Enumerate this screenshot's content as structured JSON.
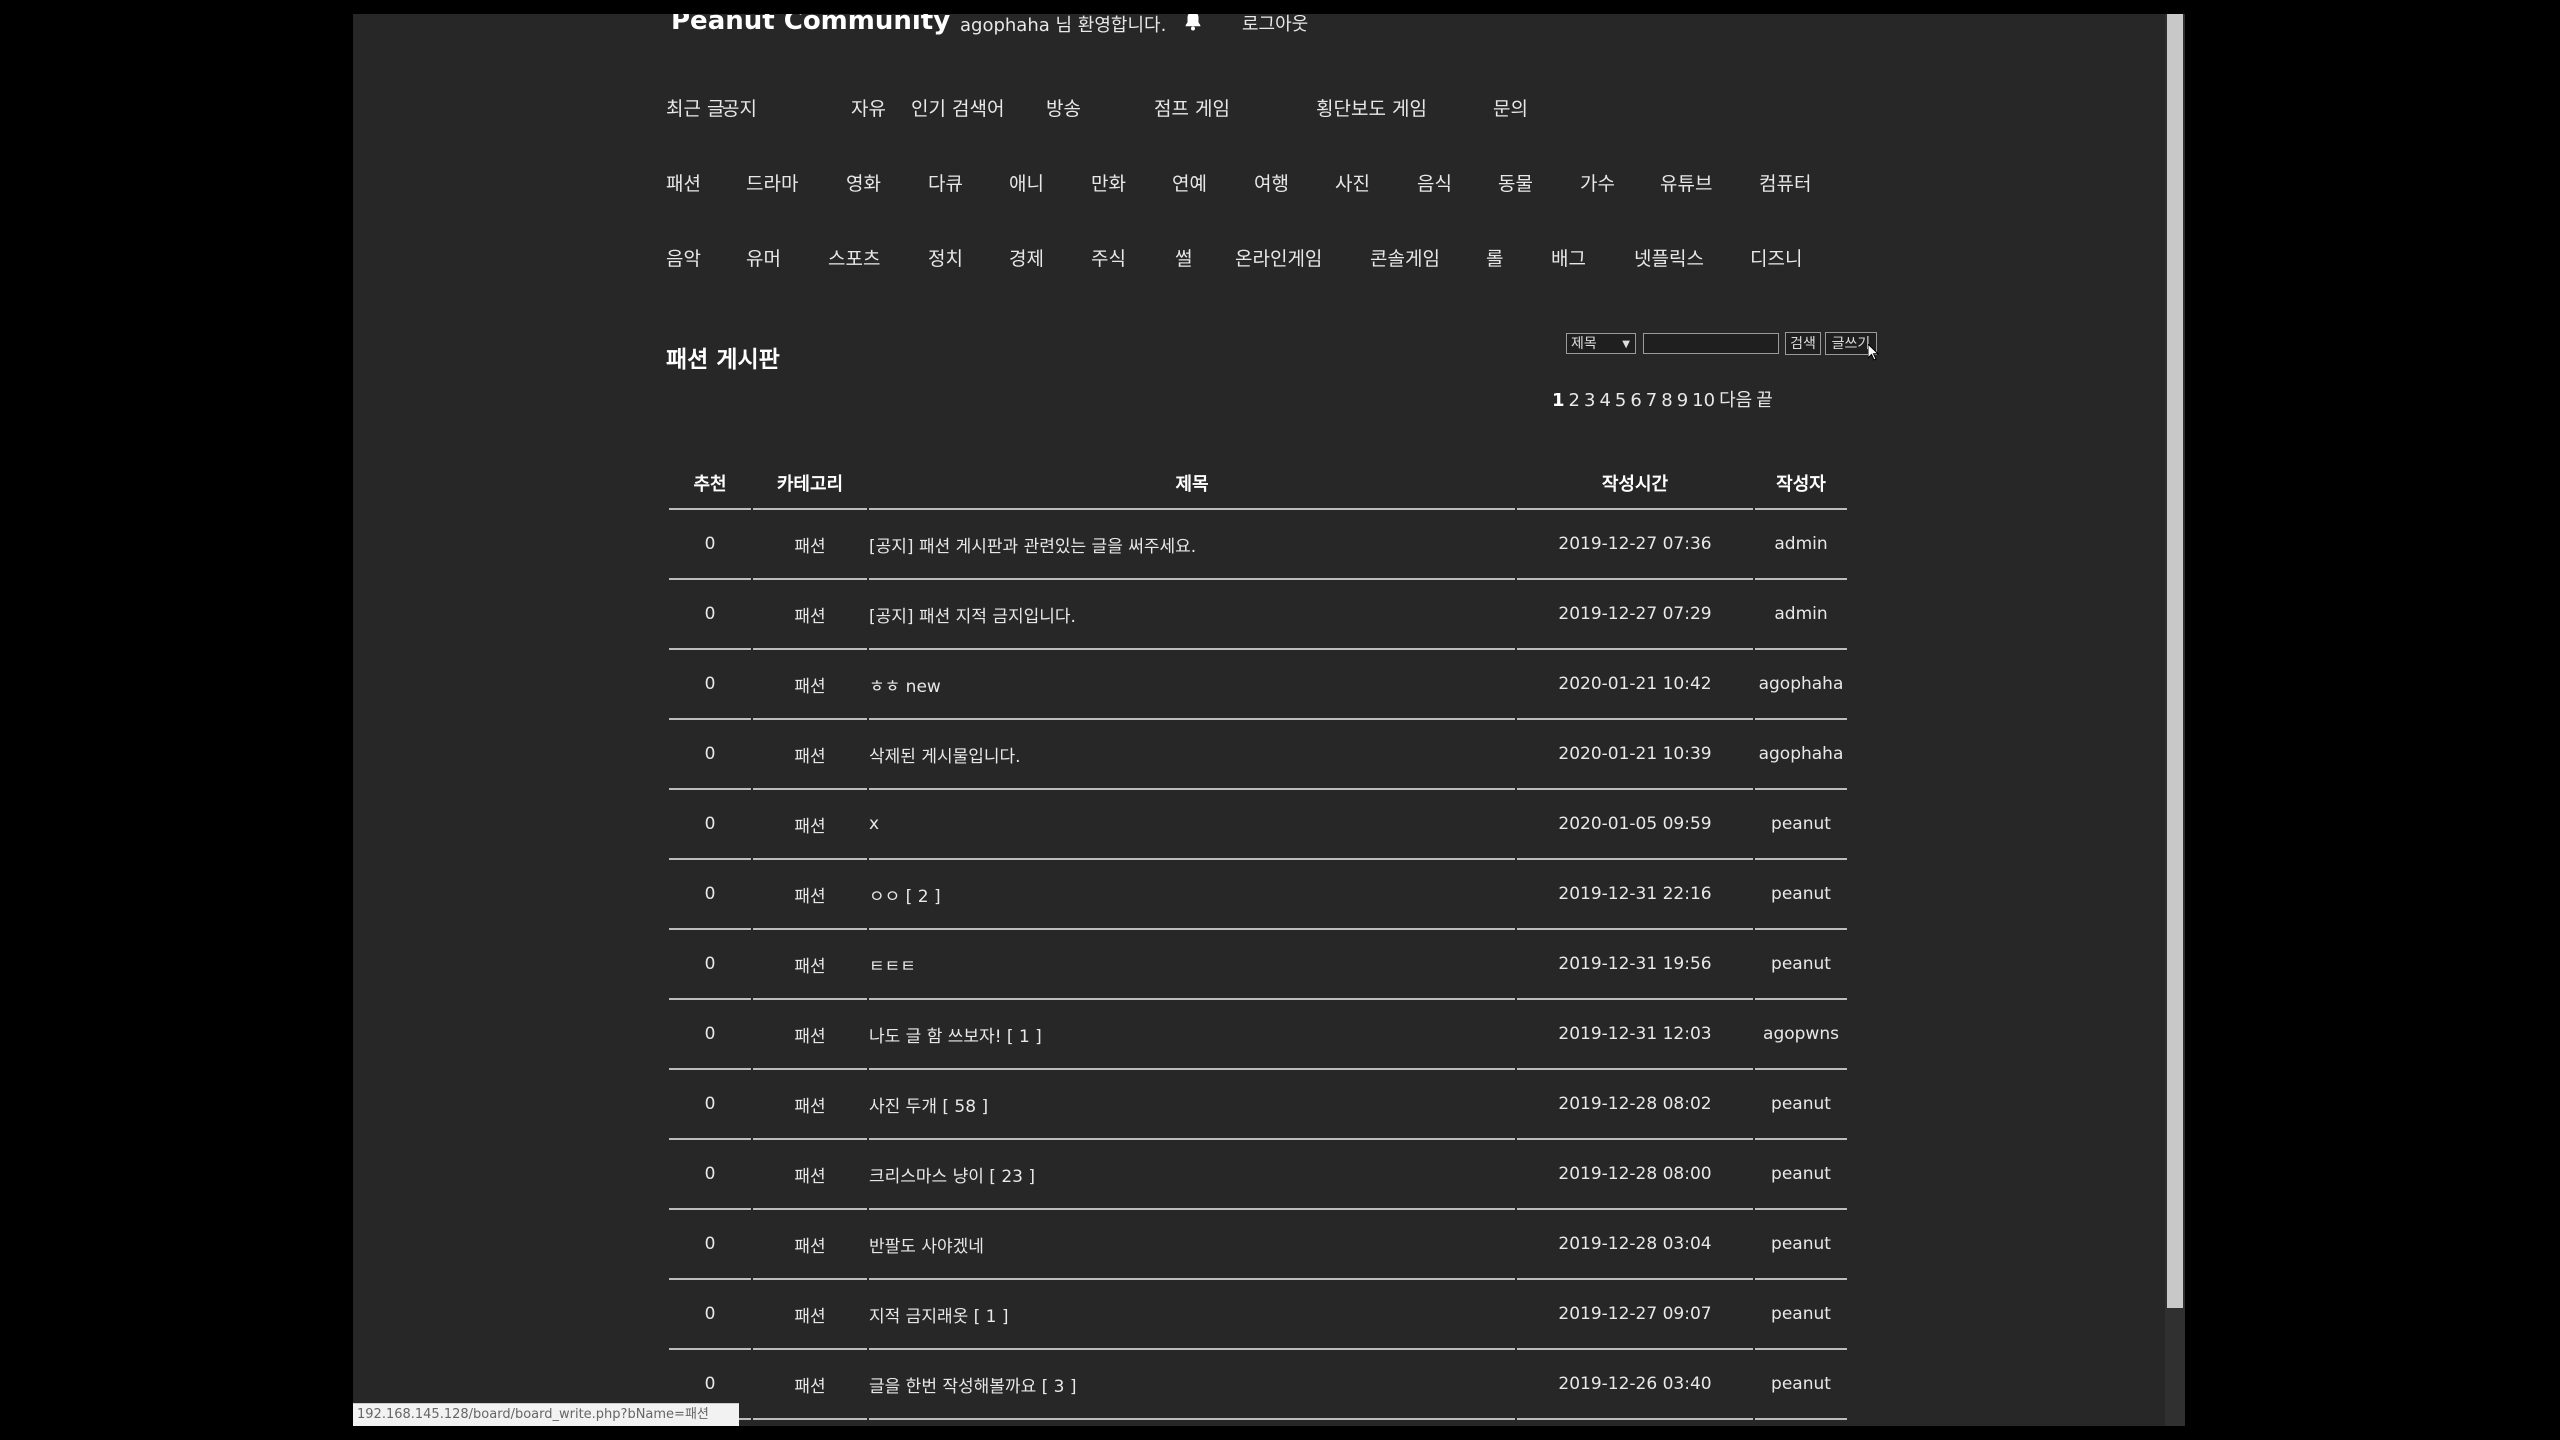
{
  "header": {
    "site_title": "Peanut Community",
    "welcome": "agophaha 님 환영합니다.",
    "logout": "로그아웃"
  },
  "nav": {
    "row1": [
      "최근 글",
      "공지",
      "자유",
      "인기 검색어",
      "방송",
      "점프 게임",
      "횡단보도 게임",
      "문의"
    ],
    "row2": [
      "패션",
      "드라마",
      "영화",
      "다큐",
      "애니",
      "만화",
      "연예",
      "여행",
      "사진",
      "음식",
      "동물",
      "가수",
      "유튜브",
      "컴퓨터"
    ],
    "row3": [
      "음악",
      "유머",
      "스포츠",
      "정치",
      "경제",
      "주식",
      "썰",
      "온라인게임",
      "콘솔게임",
      "롤",
      "배그",
      "넷플릭스",
      "디즈니"
    ]
  },
  "board": {
    "title": "패션 게시판",
    "search_select": "제목",
    "search_button": "검색",
    "write_button": "글쓰기"
  },
  "pager": {
    "pages": [
      "1",
      "2",
      "3",
      "4",
      "5",
      "6",
      "7",
      "8",
      "9",
      "10"
    ],
    "next": "다음",
    "last": "끝"
  },
  "table": {
    "headers": [
      "추천",
      "카테고리",
      "제목",
      "작성시간",
      "작성자"
    ],
    "rows": [
      [
        "0",
        "패션",
        "[공지] 패션 게시판과 관련있는 글을 써주세요.",
        "2019-12-27 07:36",
        "admin"
      ],
      [
        "0",
        "패션",
        "[공지] 패션 지적 금지입니다.",
        "2019-12-27 07:29",
        "admin"
      ],
      [
        "0",
        "패션",
        "ㅎㅎ new",
        "2020-01-21 10:42",
        "agophaha"
      ],
      [
        "0",
        "패션",
        "삭제된 게시물입니다.",
        "2020-01-21 10:39",
        "agophaha"
      ],
      [
        "0",
        "패션",
        "x",
        "2020-01-05 09:59",
        "peanut"
      ],
      [
        "0",
        "패션",
        "ㅇㅇ [ 2 ]",
        "2019-12-31 22:16",
        "peanut"
      ],
      [
        "0",
        "패션",
        "ㅌㅌㅌ",
        "2019-12-31 19:56",
        "peanut"
      ],
      [
        "0",
        "패션",
        "나도 글 함 쓰보자! [ 1 ]",
        "2019-12-31 12:03",
        "agopwns"
      ],
      [
        "0",
        "패션",
        "사진 두개 [ 58 ]",
        "2019-12-28 08:02",
        "peanut"
      ],
      [
        "0",
        "패션",
        "크리스마스 냥이 [ 23 ]",
        "2019-12-28 08:00",
        "peanut"
      ],
      [
        "0",
        "패션",
        "반팔도 사야겠네",
        "2019-12-28 03:04",
        "peanut"
      ],
      [
        "0",
        "패션",
        "지적 금지래옷 [ 1 ]",
        "2019-12-27 09:07",
        "peanut"
      ],
      [
        "0",
        "패션",
        "글을 한번 작성해볼까요 [ 3 ]",
        "2019-12-26 03:40",
        "peanut"
      ]
    ]
  },
  "status_bar": "192.168.145.128/board/board_write.php?bName=패션"
}
